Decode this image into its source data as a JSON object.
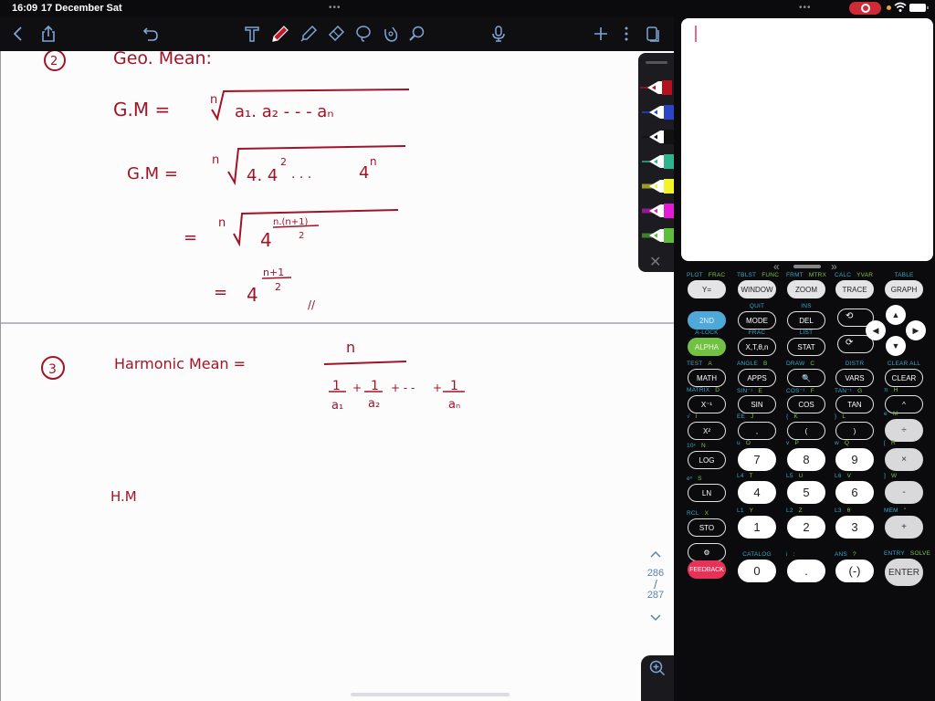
{
  "status_bar": {
    "time": "16:09",
    "date": "17 December Sat",
    "multitask_dots": "•••"
  },
  "toolbar": {
    "icons": [
      "back-icon",
      "share-icon",
      "undo-icon",
      "text-tool-icon",
      "pen-tool-icon",
      "highlighter-icon",
      "eraser-icon",
      "lasso-icon",
      "shapes-icon",
      "laser-pointer-icon",
      "microphone-icon",
      "add-page-icon",
      "more-icon",
      "pages-icon"
    ],
    "active_tool": "pen",
    "accent_color": "#c0182a"
  },
  "notes": {
    "ink_color": "#a31326",
    "section2": {
      "number": "2",
      "heading": "Geo. Mean:",
      "line1": {
        "lhs": "G.M =",
        "root_index": "n",
        "radicand": "a₁. a₂ - - -   aₙ"
      },
      "line2": {
        "lhs": "G.M =",
        "root_index": "n",
        "radicand_base": "4. 4",
        "sq": "2",
        "dots": ". . .",
        "last_base": "4",
        "last_exp": "n"
      },
      "line3": {
        "eq": "=",
        "root_index": "n",
        "base": "4",
        "exp": "n.(n+1)",
        "exp_den": "2"
      },
      "line4": {
        "eq": "=",
        "base": "4",
        "exp_num": "n+1",
        "exp_den": "2",
        "end_mark": "//"
      }
    },
    "section3": {
      "number": "3",
      "heading": "Harmonic  Mean =",
      "numerator": "n",
      "terms": [
        {
          "num": "1",
          "den": "a₁"
        },
        {
          "op": "+",
          "num": "1",
          "den": "a₂"
        },
        {
          "op": "+ - -",
          "num": "",
          "den": ""
        },
        {
          "op": "+",
          "num": "1",
          "den": "aₙ"
        }
      ],
      "line2": "H.M"
    }
  },
  "pen_tray": {
    "pens": [
      {
        "name": "red",
        "color": "#b5101e"
      },
      {
        "name": "blue",
        "color": "#2a45c8"
      },
      {
        "name": "black",
        "color": "#111111"
      },
      {
        "name": "teal",
        "color": "#2fb48f"
      },
      {
        "name": "yellow-highlighter",
        "color": "#f3f32a"
      },
      {
        "name": "magenta-highlighter",
        "color": "#e31ad6"
      },
      {
        "name": "green-highlighter",
        "color": "#5fbd3c"
      }
    ],
    "close": "✕"
  },
  "pager": {
    "up": "^",
    "current": "286",
    "separator": "/",
    "total": "287",
    "down": "v"
  },
  "calculator": {
    "screen_nav": {
      "left": "«",
      "right": "»"
    },
    "rows": [
      {
        "keys": [
          {
            "label": "Y=",
            "sec": "PLOT",
            "alpha": "FRAC"
          },
          {
            "label": "WINDOW",
            "sec": "TBLST",
            "alpha": "FUNC"
          },
          {
            "label": "ZOOM",
            "sec": "FRMT",
            "alpha": "MTRX"
          },
          {
            "label": "TRACE",
            "sec": "CALC",
            "alpha": "YVAR"
          },
          {
            "label": "GRAPH",
            "sec": "TABLE",
            "alpha": ""
          }
        ]
      },
      {
        "keys": [
          {
            "label": "2ND",
            "sec": "",
            "alpha": ""
          },
          {
            "label": "MODE",
            "sec": "QUIT",
            "alpha": ""
          },
          {
            "label": "DEL",
            "sec": "INS",
            "alpha": ""
          }
        ]
      },
      {
        "keys": [
          {
            "label": "ALPHA",
            "sec": "A-LOCK",
            "alpha": ""
          },
          {
            "label": "X,T,θ,n",
            "sec": "FRAC",
            "alpha": ""
          },
          {
            "label": "STAT",
            "sec": "LIST",
            "alpha": ""
          }
        ]
      },
      {
        "keys": [
          {
            "label": "MATH",
            "sec": "TEST",
            "alpha": "A"
          },
          {
            "label": "APPS",
            "sec": "ANGLE",
            "alpha": "B"
          },
          {
            "label": "🔍",
            "sec": "DRAW",
            "alpha": "C"
          },
          {
            "label": "VARS",
            "sec": "DISTR",
            "alpha": ""
          },
          {
            "label": "CLEAR",
            "sec": "CLEAR ALL",
            "alpha": ""
          }
        ]
      },
      {
        "keys": [
          {
            "label": "X⁻¹",
            "sec": "MATRIX",
            "alpha": "D"
          },
          {
            "label": "SIN",
            "sec": "SIN⁻¹",
            "alpha": "E"
          },
          {
            "label": "COS",
            "sec": "COS⁻¹",
            "alpha": "F"
          },
          {
            "label": "TAN",
            "sec": "TAN⁻¹",
            "alpha": "G"
          },
          {
            "label": "^",
            "sec": "π",
            "alpha": "H"
          }
        ]
      },
      {
        "keys": [
          {
            "label": "X²",
            "sec": "√",
            "alpha": "I"
          },
          {
            "label": ",",
            "sec": "EE",
            "alpha": "J"
          },
          {
            "label": "(",
            "sec": "{",
            "alpha": "K"
          },
          {
            "label": ")",
            "sec": "}",
            "alpha": "L"
          },
          {
            "label": "÷",
            "sec": "e",
            "alpha": "M"
          }
        ]
      },
      {
        "keys": [
          {
            "label": "LOG",
            "sec": "10ˣ",
            "alpha": "N"
          },
          {
            "label": "7",
            "sec": "u",
            "alpha": "O"
          },
          {
            "label": "8",
            "sec": "v",
            "alpha": "P"
          },
          {
            "label": "9",
            "sec": "w",
            "alpha": "Q"
          },
          {
            "label": "×",
            "sec": "[",
            "alpha": "R"
          }
        ]
      },
      {
        "keys": [
          {
            "label": "LN",
            "sec": "eˣ",
            "alpha": "S"
          },
          {
            "label": "4",
            "sec": "L4",
            "alpha": "T"
          },
          {
            "label": "5",
            "sec": "L5",
            "alpha": "U"
          },
          {
            "label": "6",
            "sec": "L6",
            "alpha": "V"
          },
          {
            "label": "-",
            "sec": "]",
            "alpha": "W"
          }
        ]
      },
      {
        "keys": [
          {
            "label": "STO",
            "sec": "RCL",
            "alpha": "X"
          },
          {
            "label": "1",
            "sec": "L1",
            "alpha": "Y"
          },
          {
            "label": "2",
            "sec": "L2",
            "alpha": "Z"
          },
          {
            "label": "3",
            "sec": "L3",
            "alpha": "θ"
          },
          {
            "label": "+",
            "sec": "MEM",
            "alpha": "\""
          }
        ]
      },
      {
        "keys": [
          {
            "label": "⚙",
            "sec": "",
            "alpha": ""
          },
          {
            "label": "0",
            "sec": "CATALOG",
            "alpha": ""
          },
          {
            "label": ".",
            "sec": "i",
            "alpha": ":"
          },
          {
            "label": "(-)",
            "sec": "ANS",
            "alpha": "?"
          },
          {
            "label": "ENTER",
            "sec": "ENTRY",
            "alpha": "SOLVE"
          }
        ]
      },
      {
        "keys": [
          {
            "label": "FEEDBACK",
            "sec": "",
            "alpha": ""
          }
        ]
      }
    ],
    "dpad": {
      "up": "▲",
      "down": "▼",
      "left": "◀",
      "right": "▶"
    }
  }
}
